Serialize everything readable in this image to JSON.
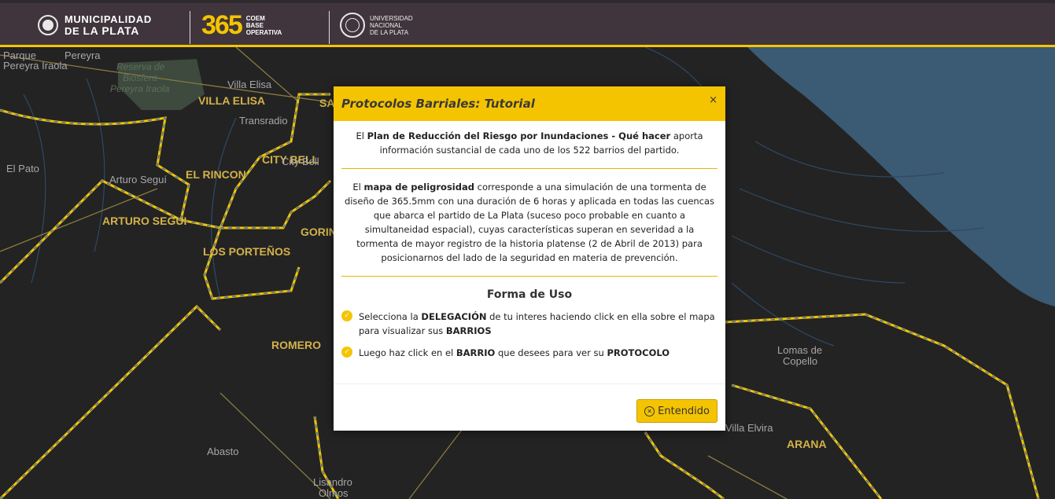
{
  "header": {
    "mlp_line1": "MUNICIPALIDAD",
    "mlp_line2_pre": "DE ",
    "mlp_line2_bold": "LA PLATA",
    "logo_365": "365",
    "coem_l1": "COEM",
    "coem_l2": "BASE",
    "coem_l3": "OPERATIVA",
    "unlp_l1": "UNIVERSIDAD",
    "unlp_l2": "NACIONAL",
    "unlp_l3": "DE LA PLATA"
  },
  "map": {
    "labels_yellow": [
      "VILLA ELISA",
      "EL RINCON",
      "CITY BELL",
      "ARTURO SEGUI",
      "LOS PORTEÑOS",
      "GORIN",
      "ROMERO",
      "ARANA",
      "SA"
    ],
    "labels_gray": [
      "Pereyra",
      "Parque",
      "Pereyra Iraola",
      "Villa Elisa",
      "Transradio",
      "El Pato",
      "Arturo Seguí",
      "City Bell",
      "Lomas de",
      "Copello",
      "Villa Elvira",
      "Abasto",
      "Lisandro",
      "Olmos"
    ],
    "labels_green": [
      "Reserva de",
      "Biosfera",
      "Pereyra Iraola"
    ],
    "colors": {
      "land": "#232323",
      "water": "#3b5a73",
      "border": "#f5c400",
      "dash": "#3f6fa8"
    }
  },
  "modal": {
    "title": "Protocolos Barriales: Tutorial",
    "close": "×",
    "p1_pre": "El ",
    "p1_bold": "Plan de Reducción del Riesgo por Inundaciones - Qué hacer",
    "p1_post": " aporta información sustancial de cada uno de los 522 barrios del partido.",
    "p2_pre": "El ",
    "p2_bold": "mapa de peligrosidad",
    "p2_post": " corresponde a una simulación de una tormenta de diseño de 365.5mm con una duración de 6 horas y aplicada en todas las cuencas que abarca el partido de La Plata (suceso poco probable en cuanto a simultaneidad espacial), cuyas características superan en severidad a la tormenta de mayor registro de la historia platense (2 de Abril de 2013) para posicionarnos del lado de la seguridad en materia de prevención.",
    "subtitle": "Forma de Uso",
    "step1_a": "Selecciona la ",
    "step1_b": "DELEGACIÓN",
    "step1_c": " de tu interes haciendo click en ella sobre el mapa para visualizar sus ",
    "step1_d": "BARRIOS",
    "step2_a": "Luego haz click en el ",
    "step2_b": "BARRIO",
    "step2_c": " que desees para ver su ",
    "step2_d": "PROTOCOLO",
    "ok_label": "Entendido"
  }
}
